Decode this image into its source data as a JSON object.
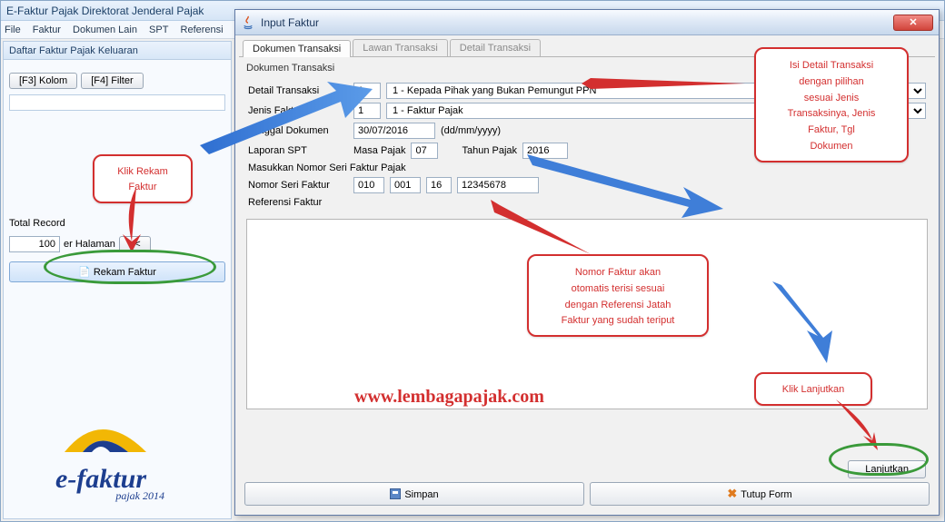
{
  "window": {
    "title": "E-Faktur Pajak Direktorat Jenderal Pajak"
  },
  "menu": [
    "File",
    "Faktur",
    "Dokumen Lain",
    "SPT",
    "Referensi"
  ],
  "sidepanel": {
    "title": "Daftar Faktur Pajak Keluaran",
    "btn_kolom": "[F3] Kolom",
    "btn_filter": "[F4] Filter",
    "total_label": "Total Record",
    "per_page_value": "100",
    "per_page_label": "er Halaman",
    "pager_prev": "<<",
    "rekam_btn": "Rekam Faktur"
  },
  "dialog": {
    "title": "Input Faktur",
    "tabs": [
      "Dokumen Transaksi",
      "Lawan Transaksi",
      "Detail Transaksi"
    ],
    "group": "Dokumen Transaksi",
    "detail_label": "Detail Transaksi",
    "detail_code": "1",
    "detail_desc": "1 - Kepada Pihak yang Bukan Pemungut PPN",
    "jenis_label": "Jenis Faktur",
    "jenis_code": "1",
    "jenis_desc": "1 - Faktur Pajak",
    "tgl_label": "Tanggal Dokumen",
    "tgl_value": "30/07/2016",
    "tgl_fmt": "(dd/mm/yyyy)",
    "laporan_label": "Laporan SPT",
    "masa_label": "Masa Pajak",
    "masa_value": "07",
    "tahun_label": "Tahun Pajak",
    "tahun_value": "2016",
    "nsf_instr": "Masukkan Nomor Seri Faktur Pajak",
    "nsf_label": "Nomor Seri Faktur",
    "nsf_parts": [
      "010",
      "001",
      "16",
      "12345678"
    ],
    "ref_label": "Referensi Faktur",
    "btn_lanjutkan": "Lanjutkan",
    "btn_simpan": "Simpan",
    "btn_tutup": "Tutup Form"
  },
  "callouts": {
    "rekam": "Klik Rekam\nFaktur",
    "detail": "Isi Detail Transaksi\ndengan pilihan\nsesuai Jenis\nTransaksinya, Jenis\nFaktur, Tgl\nDokumen",
    "nomor": "Nomor Faktur akan\notomatis terisi sesuai\ndengan Referensi Jatah\nFaktur yang sudah teriput",
    "lanjutkan": "Klik Lanjutkan"
  },
  "watermark": "www.lembagapajak.com",
  "logo": {
    "line1": "e-faktur",
    "line2": "pajak 2014"
  }
}
